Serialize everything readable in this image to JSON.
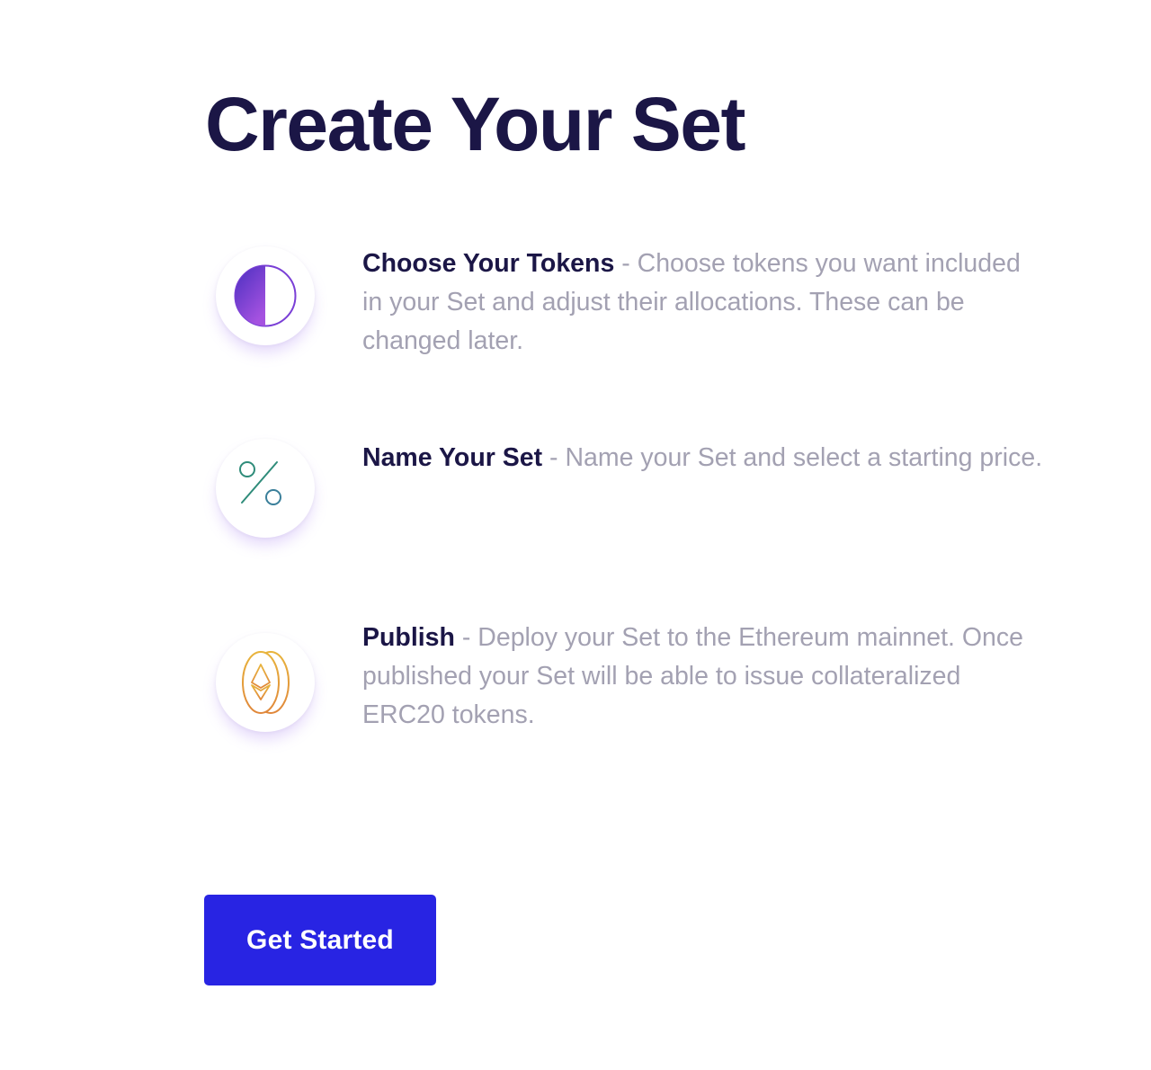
{
  "page": {
    "title": "Create Your Set"
  },
  "steps": [
    {
      "icon": "half-circle-icon",
      "title": "Choose Your Tokens",
      "separator": " - ",
      "description": "Choose tokens you want included in your Set and adjust their allocations. These can be changed later."
    },
    {
      "icon": "percent-icon",
      "title": "Name Your Set",
      "separator": " - ",
      "description": "Name your Set and select a starting price."
    },
    {
      "icon": "ethereum-coin-icon",
      "title": "Publish",
      "separator": " - ",
      "description": "Deploy your Set to the Ethereum mainnet. Once published your Set will be able to issue collateralized ERC20 tokens."
    }
  ],
  "cta": {
    "label": "Get Started"
  },
  "colors": {
    "heading": "#1b1646",
    "body_text": "#a3a1b2",
    "button": "#2824e3",
    "button_text": "#ffffff",
    "icon_purple": "#7a3fd6",
    "icon_teal": "#2f8c7a",
    "icon_gold": "#e3a43a"
  }
}
